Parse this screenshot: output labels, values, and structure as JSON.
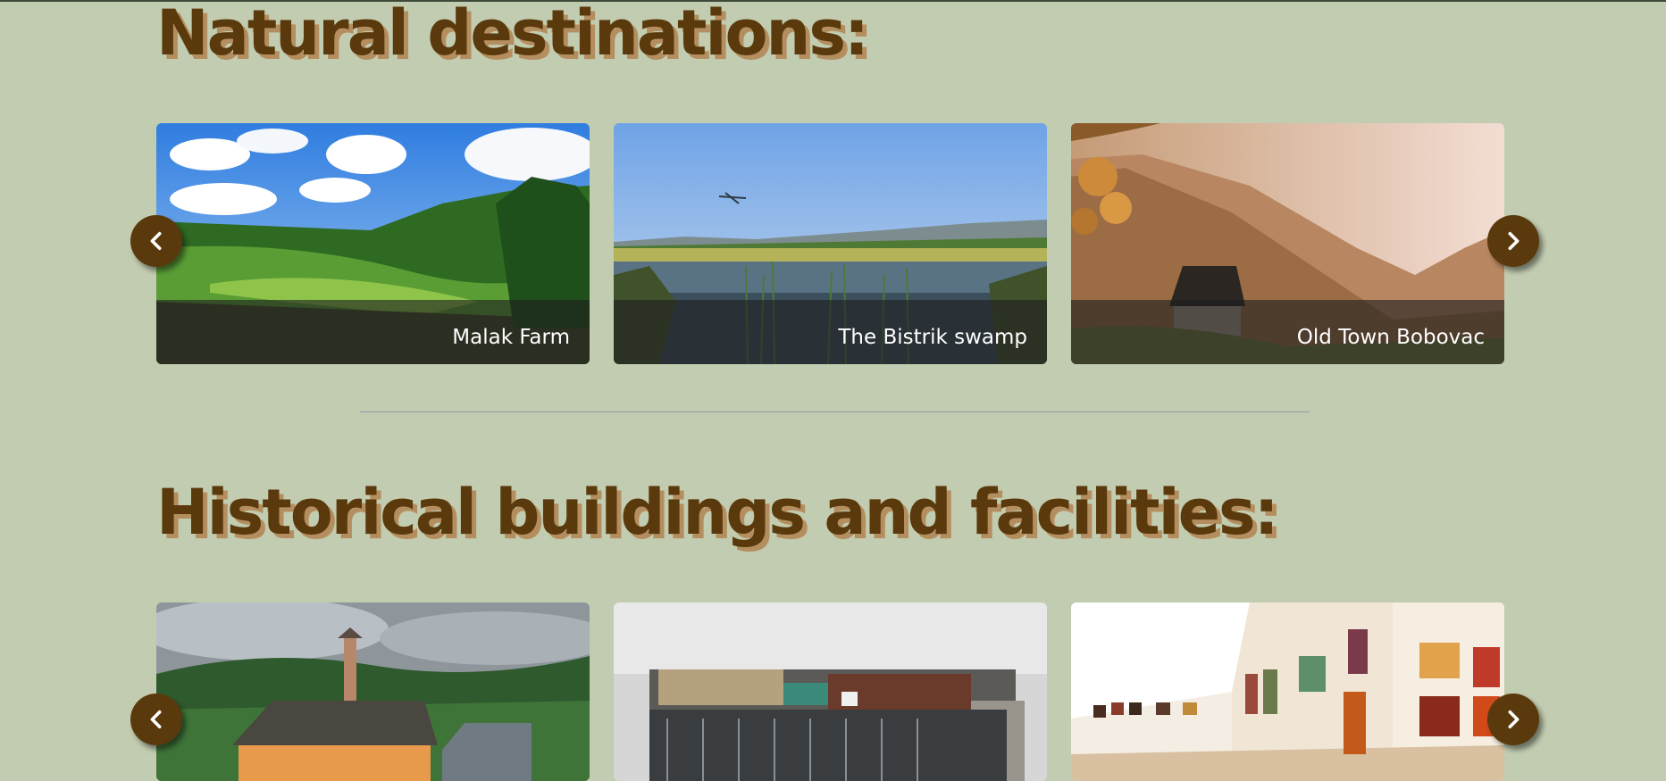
{
  "sections": [
    {
      "title": "Natural destinations:",
      "cards": [
        {
          "caption": "Malak Farm"
        },
        {
          "caption": "The Bistrik swamp"
        },
        {
          "caption": "Old Town Bobovac"
        }
      ]
    },
    {
      "title": "Historical buildings and facilities:",
      "cards": [
        {
          "caption": ""
        },
        {
          "caption": ""
        },
        {
          "caption": ""
        }
      ]
    }
  ],
  "icons": {
    "prev": "chevron-left-icon",
    "next": "chevron-right-icon"
  },
  "colors": {
    "background": "#c2ccb0",
    "title": "#5a3a0d",
    "title_shadow": "#b58e5f",
    "nav_button": "#5a3a0d"
  }
}
